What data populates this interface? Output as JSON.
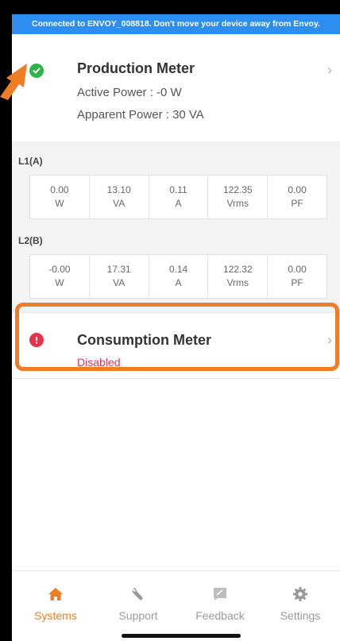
{
  "banner": {
    "text": "Connected to ENVOY_008818. Don't move your device away from Envoy."
  },
  "production_meter": {
    "title": "Production Meter",
    "active_power": "Active Power : -0 W",
    "apparent_power": "Apparent Power : 30 VA",
    "status": "ok",
    "phases": [
      {
        "label": "L1(A)",
        "cells": [
          {
            "value": "0.00",
            "unit": "W"
          },
          {
            "value": "13.10",
            "unit": "VA"
          },
          {
            "value": "0.11",
            "unit": "A"
          },
          {
            "value": "122.35",
            "unit": "Vrms"
          },
          {
            "value": "0.00",
            "unit": "PF"
          }
        ]
      },
      {
        "label": "L2(B)",
        "cells": [
          {
            "value": "-0.00",
            "unit": "W"
          },
          {
            "value": "17.31",
            "unit": "VA"
          },
          {
            "value": "0.14",
            "unit": "A"
          },
          {
            "value": "122.32",
            "unit": "Vrms"
          },
          {
            "value": "0.00",
            "unit": "PF"
          }
        ]
      }
    ]
  },
  "consumption_meter": {
    "title": "Consumption Meter",
    "status_text": "Disabled",
    "status": "error"
  },
  "bottom_nav": {
    "items": [
      {
        "label": "Systems",
        "icon": "home-icon",
        "active": true
      },
      {
        "label": "Support",
        "icon": "wrench-icon",
        "active": false
      },
      {
        "label": "Feedback",
        "icon": "feedback-icon",
        "active": false
      },
      {
        "label": "Settings",
        "icon": "gear-icon",
        "active": false
      }
    ]
  },
  "colors": {
    "banner": "#2d8ef0",
    "ok": "#2cb34a",
    "error": "#e3344c",
    "accent": "#ef7d26",
    "disabled_text": "#e0315c"
  }
}
